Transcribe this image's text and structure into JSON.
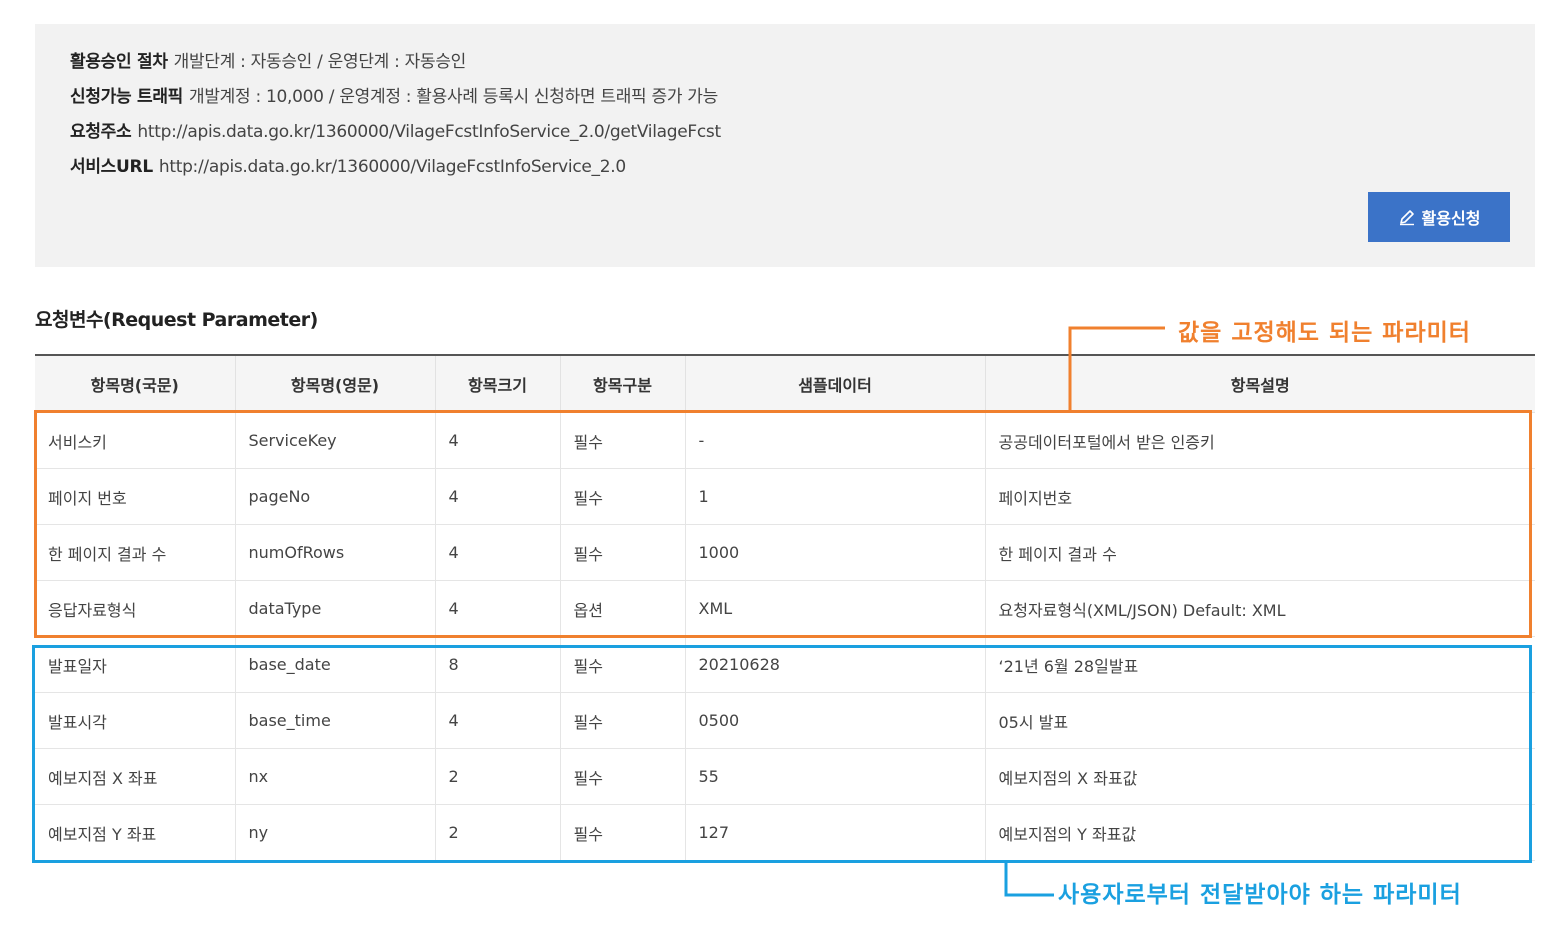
{
  "info": {
    "approval_label": "활용승인 절차",
    "approval_value": "개발단계 : 자동승인 / 운영단계 : 자동승인",
    "traffic_label": "신청가능 트래픽",
    "traffic_value": "개발계정 : 10,000 / 운영계정 : 활용사례 등록시 신청하면 트래픽 증가 가능",
    "request_url_label": "요청주소",
    "request_url_value": "http://apis.data.go.kr/1360000/VilageFcstInfoService_2.0/getVilageFcst",
    "service_url_label": "서비스URL",
    "service_url_value": "http://apis.data.go.kr/1360000/VilageFcstInfoService_2.0",
    "apply_button_label": "활용신청",
    "apply_button_icon": "pencil-icon"
  },
  "section_title": "요청변수(Request Parameter)",
  "table": {
    "headers": [
      "항목명(국문)",
      "항목명(영문)",
      "항목크기",
      "항목구분",
      "샘플데이터",
      "항목설명"
    ],
    "rows": [
      [
        "서비스키",
        "ServiceKey",
        "4",
        "필수",
        "-",
        "공공데이터포털에서 받은 인증키"
      ],
      [
        "페이지 번호",
        "pageNo",
        "4",
        "필수",
        "1",
        "페이지번호"
      ],
      [
        "한 페이지 결과 수",
        "numOfRows",
        "4",
        "필수",
        "1000",
        "한 페이지 결과 수"
      ],
      [
        "응답자료형식",
        "dataType",
        "4",
        "옵션",
        "XML",
        "요청자료형식(XML/JSON) Default: XML"
      ],
      [
        "발표일자",
        "base_date",
        "8",
        "필수",
        "20210628",
        "‘21년 6월 28일발표"
      ],
      [
        "발표시각",
        "base_time",
        "4",
        "필수",
        "0500",
        "05시 발표"
      ],
      [
        "예보지점 X 좌표",
        "nx",
        "2",
        "필수",
        "55",
        "예보지점의 X 좌표값"
      ],
      [
        "예보지점 Y 좌표",
        "ny",
        "2",
        "필수",
        "127",
        "예보지점의 Y 좌표값"
      ]
    ]
  },
  "annotations": {
    "fixed_params": "값을 고정해도 되는 파라미터",
    "user_params": "사용자로부터 전달받아야 하는 파라미터",
    "fixed_color": "#f0802e",
    "user_color": "#1aa0e0"
  },
  "colors": {
    "button": "#3b73c8",
    "info_bg": "#f2f2f2"
  }
}
